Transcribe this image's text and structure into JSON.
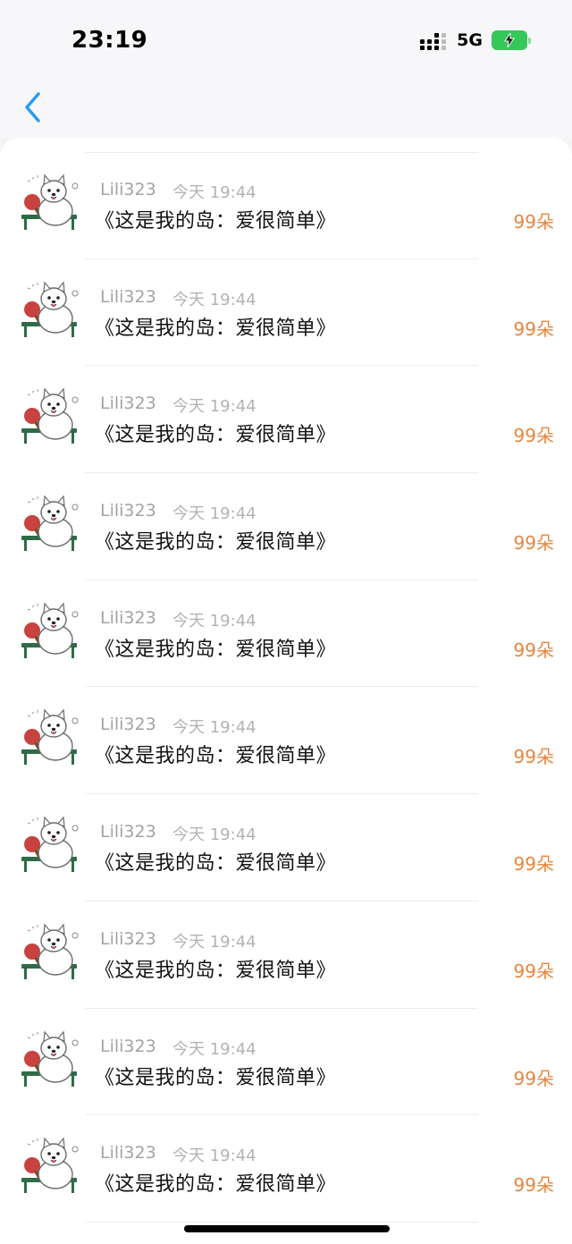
{
  "status_bar": {
    "time": "23:19",
    "network": "5G",
    "icons": [
      "signal-icon",
      "battery-charging-icon"
    ]
  },
  "nav": {
    "back_icon": "chevron-left-icon",
    "accent": "#2c9bf0"
  },
  "colors": {
    "amount": "#e8853d",
    "muted": "#a3a3a3",
    "battery": "#34c759"
  },
  "records": [
    {
      "user": "Lili323",
      "time": "今天 19:44",
      "title": "《这是我的岛：爱很简单》",
      "amount": "99朵"
    },
    {
      "user": "Lili323",
      "time": "今天 19:44",
      "title": "《这是我的岛：爱很简单》",
      "amount": "99朵"
    },
    {
      "user": "Lili323",
      "time": "今天 19:44",
      "title": "《这是我的岛：爱很简单》",
      "amount": "99朵"
    },
    {
      "user": "Lili323",
      "time": "今天 19:44",
      "title": "《这是我的岛：爱很简单》",
      "amount": "99朵"
    },
    {
      "user": "Lili323",
      "time": "今天 19:44",
      "title": "《这是我的岛：爱很简单》",
      "amount": "99朵"
    },
    {
      "user": "Lili323",
      "time": "今天 19:44",
      "title": "《这是我的岛：爱很简单》",
      "amount": "99朵"
    },
    {
      "user": "Lili323",
      "time": "今天 19:44",
      "title": "《这是我的岛：爱很简单》",
      "amount": "99朵"
    },
    {
      "user": "Lili323",
      "time": "今天 19:44",
      "title": "《这是我的岛：爱很简单》",
      "amount": "99朵"
    },
    {
      "user": "Lili323",
      "time": "今天 19:44",
      "title": "《这是我的岛：爱很简单》",
      "amount": "99朵"
    },
    {
      "user": "Lili323",
      "time": "今天 19:44",
      "title": "《这是我的岛：爱很简单》",
      "amount": "99朵"
    }
  ]
}
